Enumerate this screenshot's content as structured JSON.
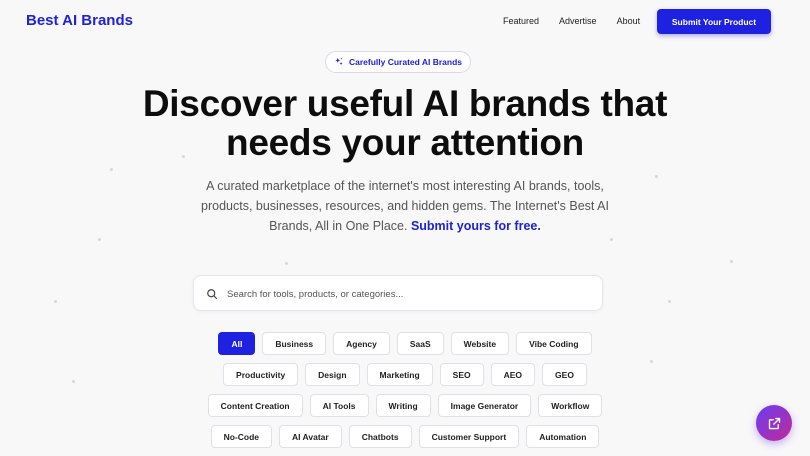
{
  "header": {
    "logo": "Best AI Brands",
    "nav": [
      "Featured",
      "Advertise",
      "About"
    ],
    "submit_label": "Submit Your Product"
  },
  "hero": {
    "badge": "Carefully Curated AI Brands",
    "title_line1": "Discover useful AI brands that",
    "title_line2": "needs your attention",
    "subtitle": "A curated marketplace of the internet's most interesting AI brands, tools, products, businesses, resources, and hidden gems. The Internet's Best AI Brands, All in One Place.",
    "subtitle_link": "Submit yours for free."
  },
  "search": {
    "placeholder": "Search for tools, products, or categories...",
    "icon": "search-icon"
  },
  "categories": {
    "row1": [
      "All",
      "Business",
      "Agency",
      "SaaS",
      "Website",
      "Vibe Coding"
    ],
    "row2": [
      "Productivity",
      "Design",
      "Marketing",
      "SEO",
      "AEO",
      "GEO"
    ],
    "row3": [
      "Content Creation",
      "AI Tools",
      "Writing",
      "Image Generator",
      "Workflow"
    ],
    "row4": [
      "No-Code",
      "AI Avatar",
      "Chatbots",
      "Customer Support",
      "Automation"
    ],
    "active": "All"
  },
  "colors": {
    "accent": "#1e22e0",
    "background": "#f8f8f9",
    "fab_gradient": [
      "#6b3df0",
      "#c02a9a"
    ]
  }
}
